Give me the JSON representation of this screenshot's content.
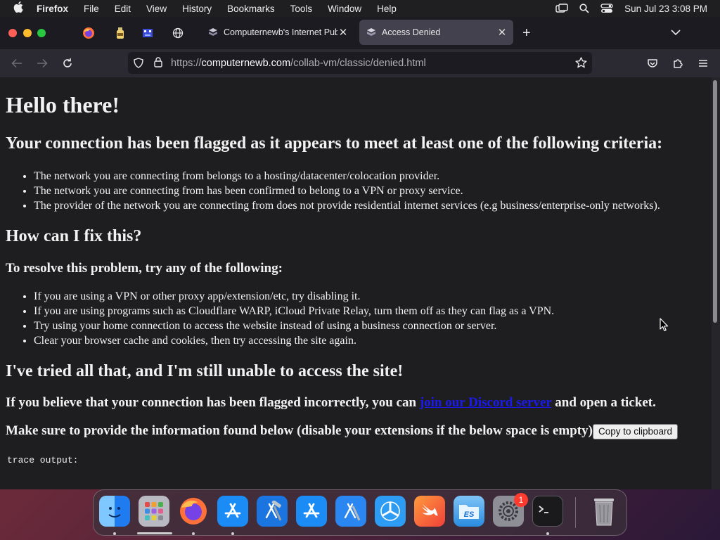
{
  "menubar": {
    "app": "Firefox",
    "items": [
      "File",
      "Edit",
      "View",
      "History",
      "Bookmarks",
      "Tools",
      "Window",
      "Help"
    ],
    "clock": "Sun Jul 23  3:08 PM"
  },
  "browser": {
    "tabs": [
      {
        "title": "Computernewb's Internet Pub H",
        "active": false
      },
      {
        "title": "Access Denied",
        "active": true
      }
    ],
    "url": {
      "scheme": "https://",
      "host": "computernewb.com",
      "path": "/collab-vm/classic/denied.html"
    }
  },
  "page": {
    "h1": "Hello there!",
    "h2_flagged": "Your connection has been flagged as it appears to meet at least one of the following criteria:",
    "criteria": [
      "The network you are connecting from belongs to a hosting/datacenter/colocation provider.",
      "The network you are connecting from has been confirmed to belong to a VPN or proxy service.",
      "The provider of the network you are connecting from does not provide residential internet services (e.g business/enterprise-only networks)."
    ],
    "h2_fix": "How can I fix this?",
    "h3_resolve": "To resolve this problem, try any of the following:",
    "fixes": [
      "If you are using a VPN or other proxy app/extension/etc, try disabling it.",
      "If you are using programs such as Cloudflare WARP, iCloud Private Relay, turn them off as they can flag as a VPN.",
      "Try using your home connection to access the website instead of using a business connection or server.",
      "Clear your browser cache and cookies, then try accessing the site again."
    ],
    "h2_tried": "I've tried all that, and I'm still unable to access the site!",
    "incorrect_prefix": "If you believe that your connection has been flagged incorrectly, you can ",
    "discord_link": "join our Discord server",
    "incorrect_suffix": " and open a ticket.",
    "info_text": "Make sure to provide the information found below (disable your extensions if the below space is empty):",
    "copy_button": "Copy to clipboard",
    "trace_label": "trace output:"
  },
  "dock": {
    "apps": [
      "finder-icon",
      "launchpad-icon",
      "firefox-icon",
      "app-store-icon",
      "xcode-icon",
      "app-store-icon",
      "xcode-icon",
      "testflight-icon",
      "swift-playgrounds-icon",
      "es-file-explorer-icon",
      "system-settings-icon",
      "terminal-icon",
      "trash-icon"
    ],
    "settings_badge": "1"
  },
  "colors": {
    "accent_link": "#1a1aee",
    "page_bg": "#1e1e20",
    "toolbar_bg": "#2b2a33"
  }
}
